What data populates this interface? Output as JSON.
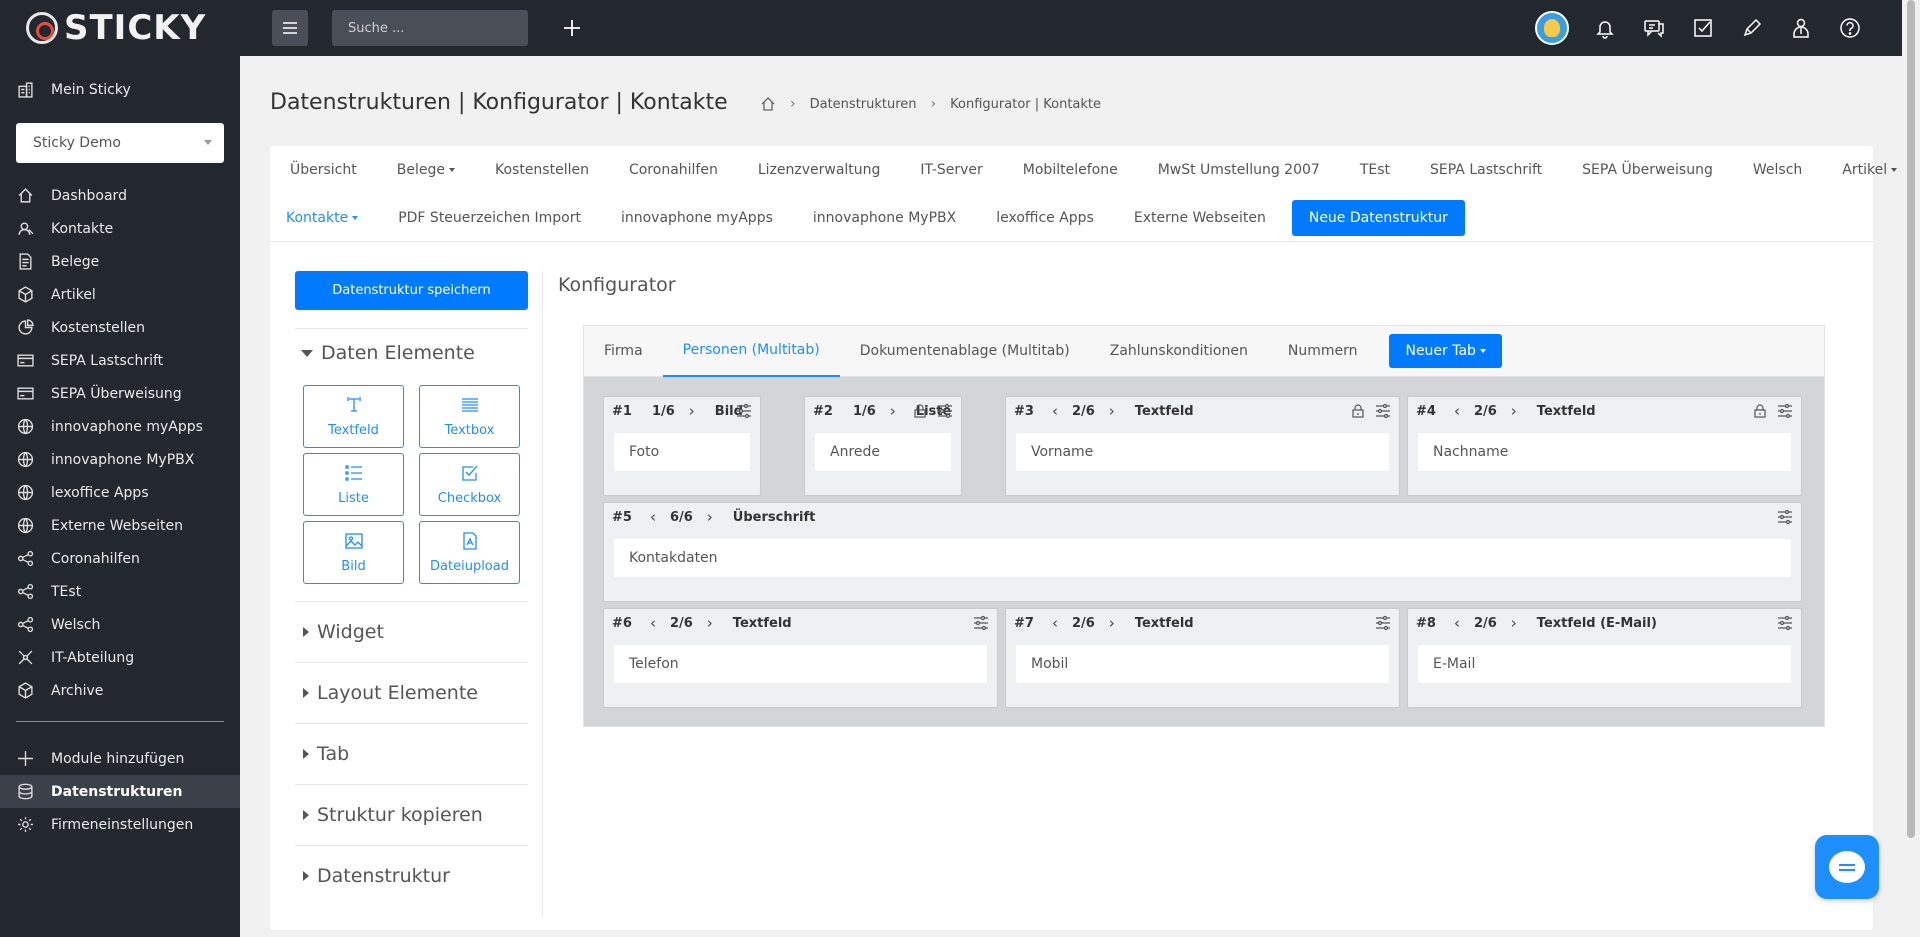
{
  "app": {
    "logo_text": "STICKY"
  },
  "sidebar": {
    "top_item": {
      "label": "Mein Sticky",
      "icon": "building-icon"
    },
    "tenant": "Sticky Demo",
    "items": [
      {
        "label": "Dashboard",
        "icon": "home-icon"
      },
      {
        "label": "Kontakte",
        "icon": "contacts-icon"
      },
      {
        "label": "Belege",
        "icon": "document-icon"
      },
      {
        "label": "Artikel",
        "icon": "box-icon"
      },
      {
        "label": "Kostenstellen",
        "icon": "pie-icon"
      },
      {
        "label": "SEPA Lastschrift",
        "icon": "card-icon"
      },
      {
        "label": "SEPA Überweisung",
        "icon": "card-icon"
      },
      {
        "label": "innovaphone myApps",
        "icon": "globe-icon"
      },
      {
        "label": "innovaphone MyPBX",
        "icon": "globe-icon"
      },
      {
        "label": "lexoffice Apps",
        "icon": "globe-icon"
      },
      {
        "label": "Externe Webseiten",
        "icon": "globe-icon"
      },
      {
        "label": "Coronahilfen",
        "icon": "share-icon"
      },
      {
        "label": "TEst",
        "icon": "share-icon"
      },
      {
        "label": "Welsch",
        "icon": "share-icon"
      },
      {
        "label": "IT-Abteilung",
        "icon": "network-icon"
      },
      {
        "label": "Archive",
        "icon": "box-icon"
      }
    ],
    "bottom_items": [
      {
        "label": "Module hinzufügen",
        "icon": "plus-icon"
      },
      {
        "label": "Datenstrukturen",
        "icon": "database-icon"
      },
      {
        "label": "Firmeneinstellungen",
        "icon": "gear-icon"
      }
    ]
  },
  "topbar": {
    "search_placeholder": "Suche ..."
  },
  "page": {
    "title": "Datenstrukturen | Konfigurator | Kontakte",
    "breadcrumb": [
      "Datenstrukturen",
      "Konfigurator | Kontakte"
    ]
  },
  "nav_tabs": {
    "row1": [
      "Übersicht",
      "Belege",
      "Kostenstellen",
      "Coronahilfen",
      "Lizenzverwaltung",
      "IT-Server",
      "Mobiltelefone",
      "MwSt Umstellung 2007",
      "TEst",
      "SEPA Lastschrift",
      "SEPA Überweisung",
      "Welsch",
      "Artikel"
    ],
    "row2": [
      "Kontakte",
      "PDF Steuerzeichen Import",
      "innovaphone myApps",
      "innovaphone MyPBX",
      "lexoffice Apps",
      "Externe Webseiten"
    ],
    "new_button": "Neue Datenstruktur"
  },
  "left_panel": {
    "save_button": "Datenstruktur speichern",
    "sections": [
      "Daten Elemente",
      "Widget",
      "Layout Elemente",
      "Tab",
      "Struktur kopieren",
      "Datenstruktur"
    ],
    "elements": [
      {
        "label": "Textfeld",
        "icon": "text-field-icon"
      },
      {
        "label": "Textbox",
        "icon": "textbox-icon"
      },
      {
        "label": "Liste",
        "icon": "list-icon"
      },
      {
        "label": "Checkbox",
        "icon": "checkbox-icon"
      },
      {
        "label": "Bild",
        "icon": "image-icon"
      },
      {
        "label": "Dateiupload",
        "icon": "file-upload-icon"
      }
    ]
  },
  "configurator": {
    "title": "Konfigurator",
    "tabs": [
      "Firma",
      "Personen (Multitab)",
      "Dokumentenablage (Multitab)",
      "Zahlunskonditionen",
      "Nummern"
    ],
    "active_tab": "Personen (Multitab)",
    "new_tab_button": "Neuer Tab",
    "fields": [
      {
        "num": "#1",
        "pos": "1/6",
        "type": "Bild",
        "value": "Foto",
        "locked": false
      },
      {
        "num": "#2",
        "pos": "1/6",
        "type": "Liste",
        "value": "Anrede",
        "locked": true
      },
      {
        "num": "#3",
        "pos": "2/6",
        "type": "Textfeld",
        "value": "Vorname",
        "locked": true
      },
      {
        "num": "#4",
        "pos": "2/6",
        "type": "Textfeld",
        "value": "Nachname",
        "locked": true
      },
      {
        "num": "#5",
        "pos": "6/6",
        "type": "Überschrift",
        "value": "Kontakdaten",
        "locked": false
      },
      {
        "num": "#6",
        "pos": "2/6",
        "type": "Textfeld",
        "value": "Telefon",
        "locked": false
      },
      {
        "num": "#7",
        "pos": "2/6",
        "type": "Textfeld",
        "value": "Mobil",
        "locked": false
      },
      {
        "num": "#8",
        "pos": "2/6",
        "type": "Textfeld (E-Mail)",
        "value": "E-Mail",
        "locked": false
      }
    ]
  },
  "colors": {
    "sidebar_bg": "#23272e",
    "accent": "#007bff",
    "canvas_bg": "#d4d5d7"
  }
}
